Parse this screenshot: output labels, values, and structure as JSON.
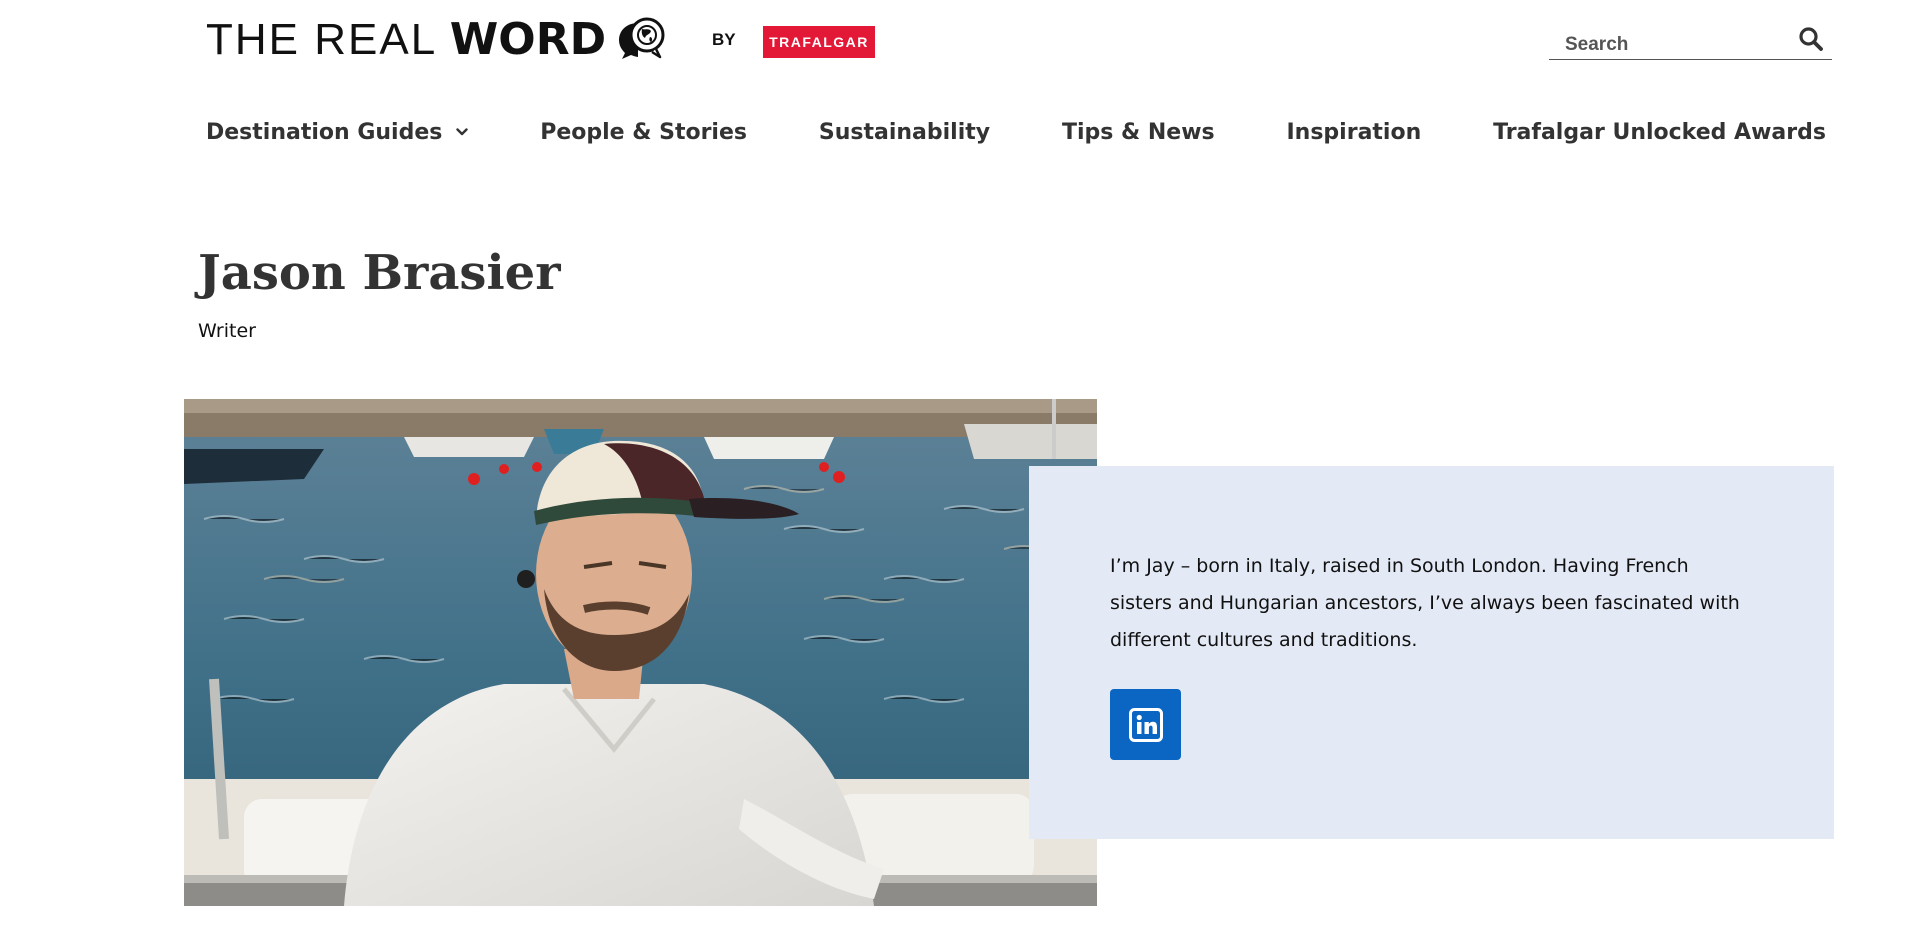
{
  "header": {
    "logo": {
      "light": "THE REAL ",
      "bold": "WORD",
      "icon": "globe-speech-bubble-icon"
    },
    "by_label": "BY",
    "brand_badge": "TRAFALGAR",
    "brand_color": "#e31837",
    "search": {
      "placeholder": "Search",
      "value": "",
      "icon": "search-icon"
    }
  },
  "nav": {
    "items": [
      {
        "label": "Destination Guides",
        "has_dropdown": true
      },
      {
        "label": "People & Stories"
      },
      {
        "label": "Sustainability"
      },
      {
        "label": "Tips & News"
      },
      {
        "label": "Inspiration"
      },
      {
        "label": "Trafalgar Unlocked Awards"
      }
    ]
  },
  "author": {
    "name": "Jason Brasier",
    "role": "Writer",
    "bio": "I’m Jay – born in Italy, raised in South London. Having French sisters and Hungarian ancestors, I’ve always been fascinated with different cultures and traditions.",
    "social": {
      "icon": "linkedin-icon",
      "color": "#0a66c2"
    },
    "card_color": "#e3e9f5"
  }
}
